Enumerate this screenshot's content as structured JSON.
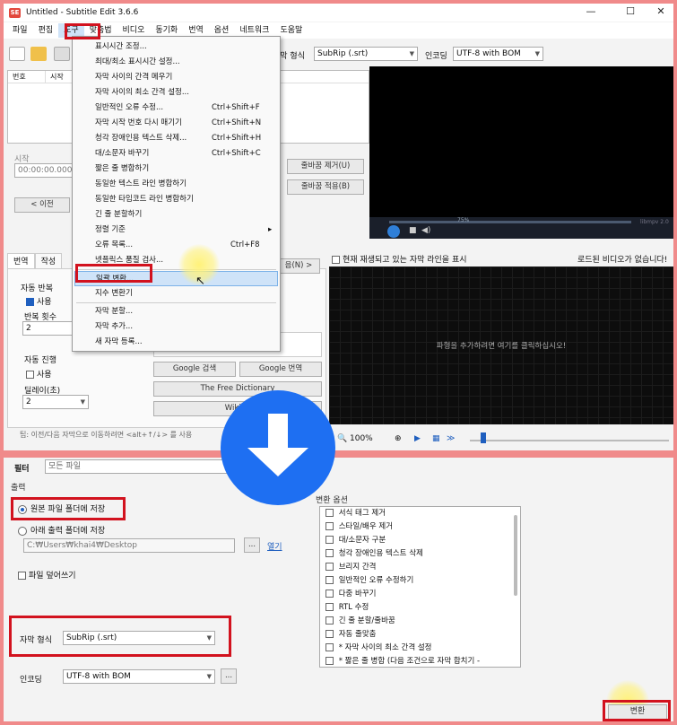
{
  "window": {
    "title": "Untitled - Subtitle Edit 3.6.6",
    "app_icon": "SE",
    "minimize": "—",
    "maximize": "☐",
    "close": "✕"
  },
  "menu": [
    "파일",
    "편집",
    "도구",
    "맞춤법",
    "비디오",
    "동기화",
    "번역",
    "옵션",
    "네트워크",
    "도움말"
  ],
  "toolbar": {
    "format_label": "자막 형식",
    "format_value": "SubRip (.srt)",
    "encoding_label": "인코딩",
    "encoding_value": "UTF-8 with BOM"
  },
  "grid": {
    "col_number": "번호",
    "col_start": "시작"
  },
  "edit": {
    "start_label": "시작",
    "start_value": "00:00:00.000",
    "prev_button": "< 이전",
    "remove_linebreak": "줄바꿈 제거(U)",
    "apply_linebreak": "줄바꿈 적용(B)",
    "next_button": "음(N) >"
  },
  "video": {
    "percent": "75%",
    "brand": "libmpv 2.0"
  },
  "tools_menu": [
    {
      "label": "표시시간 조정...",
      "shortcut": ""
    },
    {
      "label": "최대/최소 표시시간 설정...",
      "shortcut": ""
    },
    {
      "label": "자막 사이의 간격 메우기",
      "shortcut": ""
    },
    {
      "label": "자막 사이의 최소 간격 설정...",
      "shortcut": ""
    },
    {
      "label": "일반적인 오류 수정...",
      "shortcut": "Ctrl+Shift+F"
    },
    {
      "label": "자막 시작 번호 다시 매기기",
      "shortcut": "Ctrl+Shift+N"
    },
    {
      "label": "청각 장애인용 텍스트 삭제...",
      "shortcut": "Ctrl+Shift+H"
    },
    {
      "label": "대/소문자 바꾸기",
      "shortcut": "Ctrl+Shift+C"
    },
    {
      "label": "짧은 줄 병합하기",
      "shortcut": ""
    },
    {
      "label": "동일한 텍스트 라인 병합하기",
      "shortcut": ""
    },
    {
      "label": "동일한 타임코드 라인 병합하기",
      "shortcut": ""
    },
    {
      "label": "긴 줄 분할하기",
      "shortcut": ""
    },
    {
      "label": "정렬 기준",
      "shortcut": "▸"
    },
    {
      "label": "오류 목록...",
      "shortcut": "Ctrl+F8"
    },
    {
      "label": "넷플릭스 품질 검사...",
      "shortcut": ""
    },
    {
      "label": "일괄 변환...",
      "shortcut": ""
    },
    {
      "label": "지수 변환기",
      "shortcut": ""
    },
    {
      "label": "자막 분할...",
      "shortcut": ""
    },
    {
      "label": "자막 추가...",
      "shortcut": ""
    },
    {
      "label": "새 자막 등록...",
      "shortcut": ""
    }
  ],
  "translate_tab": {
    "tab1": "번역",
    "tab2": "작성",
    "auto_repeat": "자동 반복",
    "use": "사용",
    "repeat_count": "반복 횟수",
    "repeat_value": "2",
    "auto_continue": "자동 진행",
    "use2": "사용",
    "delay": "딜레이(초)",
    "delay_value": "2",
    "google_search": "Google 검색",
    "google_translate": "Google 번역",
    "free_dictionary": "The Free Dictionary",
    "wikipedia": "Wikipe",
    "tip": "팁: 이전/다음 자막으로 이동하려면 <alt+↑/↓> 를 사용"
  },
  "waveform": {
    "show_current": "현재 재생되고 있는 자막 라인을 표시",
    "no_video": "로드된 비디오가 없습니다!",
    "click_hint": "파형을 추가하려면 여기를 클릭하십시오!",
    "zoom": "100%"
  },
  "batch": {
    "filter_label": "필터",
    "filter_value": "모든 파일",
    "output_label": "출력",
    "save_source": "원본 파일 폴더에 저장",
    "save_below": "아래 출력 폴더에 저장",
    "path": "C:₩Users₩khai4₩Desktop",
    "browse": "...",
    "open": "열기",
    "overwrite": "파일 덮어쓰기",
    "format_label": "자막 형식",
    "format_value": "SubRip (.srt)",
    "encoding_label": "인코딩",
    "encoding_value": "UTF-8 with BOM",
    "encoding_btn": "...",
    "options_label": "변환 옵션",
    "convert_button": "변환",
    "options": [
      "서식 태그 제거",
      "스타일/배우 제거",
      "대/소문자 구분",
      "청각 장애인용 텍스트 삭제",
      "브리지 간격",
      "일반적인 오류 수정하기",
      "다중 바꾸기",
      "RTL 수정",
      "긴 줄 분할/줄바꿈",
      "자동 줄맞춤",
      "* 자막 사이의 최소 간격 설정",
      "* 짧은 줄 병합 (다음 조건으로 자막 합치기 -"
    ]
  }
}
